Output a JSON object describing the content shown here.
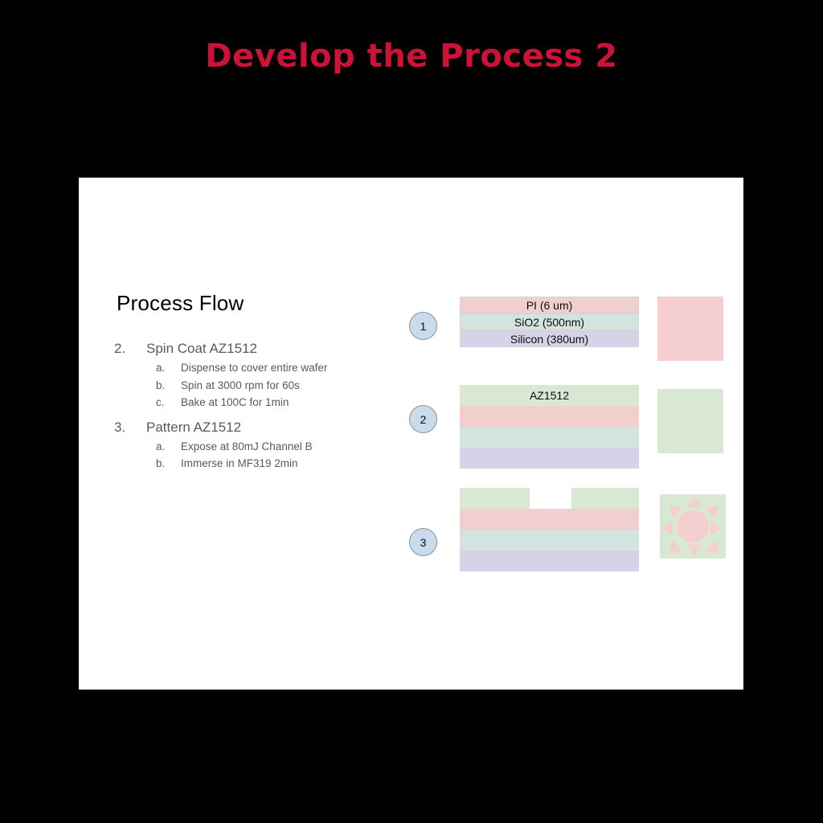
{
  "title": "Develop the Process 2",
  "slide": {
    "heading": "Process Flow",
    "list": [
      {
        "marker": "2.",
        "text": "Spin Coat AZ1512",
        "level": 1
      },
      {
        "marker": "a.",
        "text": "Dispense to cover entire wafer",
        "level": 2
      },
      {
        "marker": "b.",
        "text": "Spin at 3000 rpm for 60s",
        "level": 2
      },
      {
        "marker": "c.",
        "text": "Bake at 100C for 1min",
        "level": 2
      },
      {
        "marker": "3.",
        "text": "Pattern AZ1512",
        "level": 1
      },
      {
        "marker": "a.",
        "text": "Expose at 80mJ Channel B",
        "level": 2
      },
      {
        "marker": "b.",
        "text": "Immerse in MF319 2min",
        "level": 2
      }
    ],
    "steps": [
      {
        "badge": "1",
        "layers": [
          {
            "label": "PI (6 um)",
            "color": "#f2cfcf"
          },
          {
            "label": "SiO2 (500nm)",
            "color": "#d3e3e0"
          },
          {
            "label": "Silicon (380um)",
            "color": "#d6d2e8"
          }
        ],
        "swatch": {
          "color": "#f5cfcf",
          "icon": "none"
        }
      },
      {
        "badge": "2",
        "layers": [
          {
            "label": "AZ1512",
            "color": "#d9e8d2"
          },
          {
            "label": "",
            "color": "#f2cfcf"
          },
          {
            "label": "",
            "color": "#d3e3e0"
          },
          {
            "label": "",
            "color": "#d6d2e8"
          }
        ],
        "swatch": {
          "color": "#d9e8d2",
          "icon": "none"
        }
      },
      {
        "badge": "3",
        "layers": [
          {
            "label": "",
            "color": "#d9e8d2",
            "patterned": true
          },
          {
            "label": "",
            "color": "#f2cfcf"
          },
          {
            "label": "",
            "color": "#d3e3e0"
          },
          {
            "label": "",
            "color": "#d6d2e8"
          }
        ],
        "swatch": {
          "color": "#d9e8d2",
          "icon": "sun-icon",
          "icon_color": "#f5cfcf"
        }
      }
    ]
  },
  "colors": {
    "title": "#cc1236",
    "heading": "#000000",
    "body_text": "#595959",
    "slide_bg": "#ffffff",
    "page_bg": "#000000",
    "badge_fill": "#c8dceb",
    "badge_border": "#8f9094",
    "pi": "#f2cfcf",
    "sio2": "#d3e3e0",
    "silicon": "#d6d2e8",
    "az1512": "#d9e8d2"
  }
}
